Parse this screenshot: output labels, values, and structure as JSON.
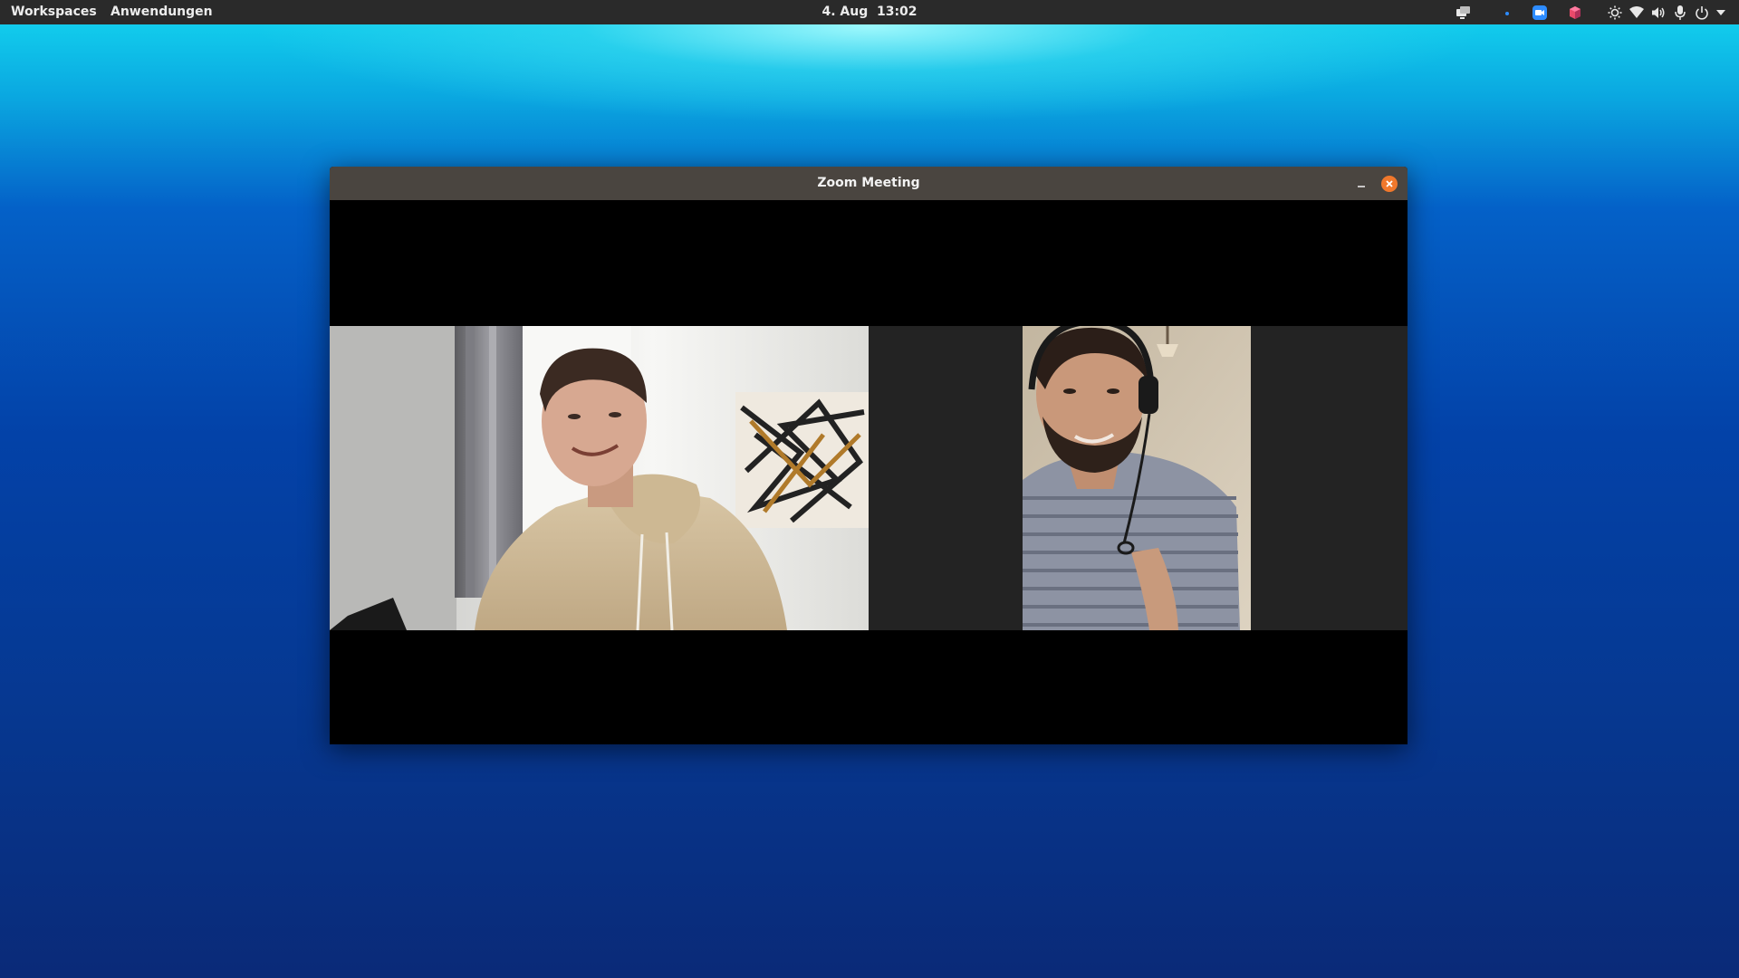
{
  "top_panel": {
    "workspaces_label": "Workspaces",
    "applications_label": "Anwendungen",
    "date": "4. Aug",
    "time": "13:02",
    "tray_icons": [
      "screen-share-icon",
      "dot-indicator-icon",
      "zoom-icon",
      "app-cube-icon",
      "brightness-icon",
      "wifi-icon",
      "volume-icon",
      "microphone-icon",
      "power-icon",
      "dropdown-arrow-icon"
    ]
  },
  "window": {
    "title": "Zoom Meeting",
    "close_color": "#f0782c"
  },
  "participants": [
    "participant-video-1",
    "participant-video-2"
  ],
  "colors": {
    "panel_bg": "#2a2a2a",
    "titlebar_bg": "#4a4540",
    "video_strip_bg": "#232323"
  }
}
